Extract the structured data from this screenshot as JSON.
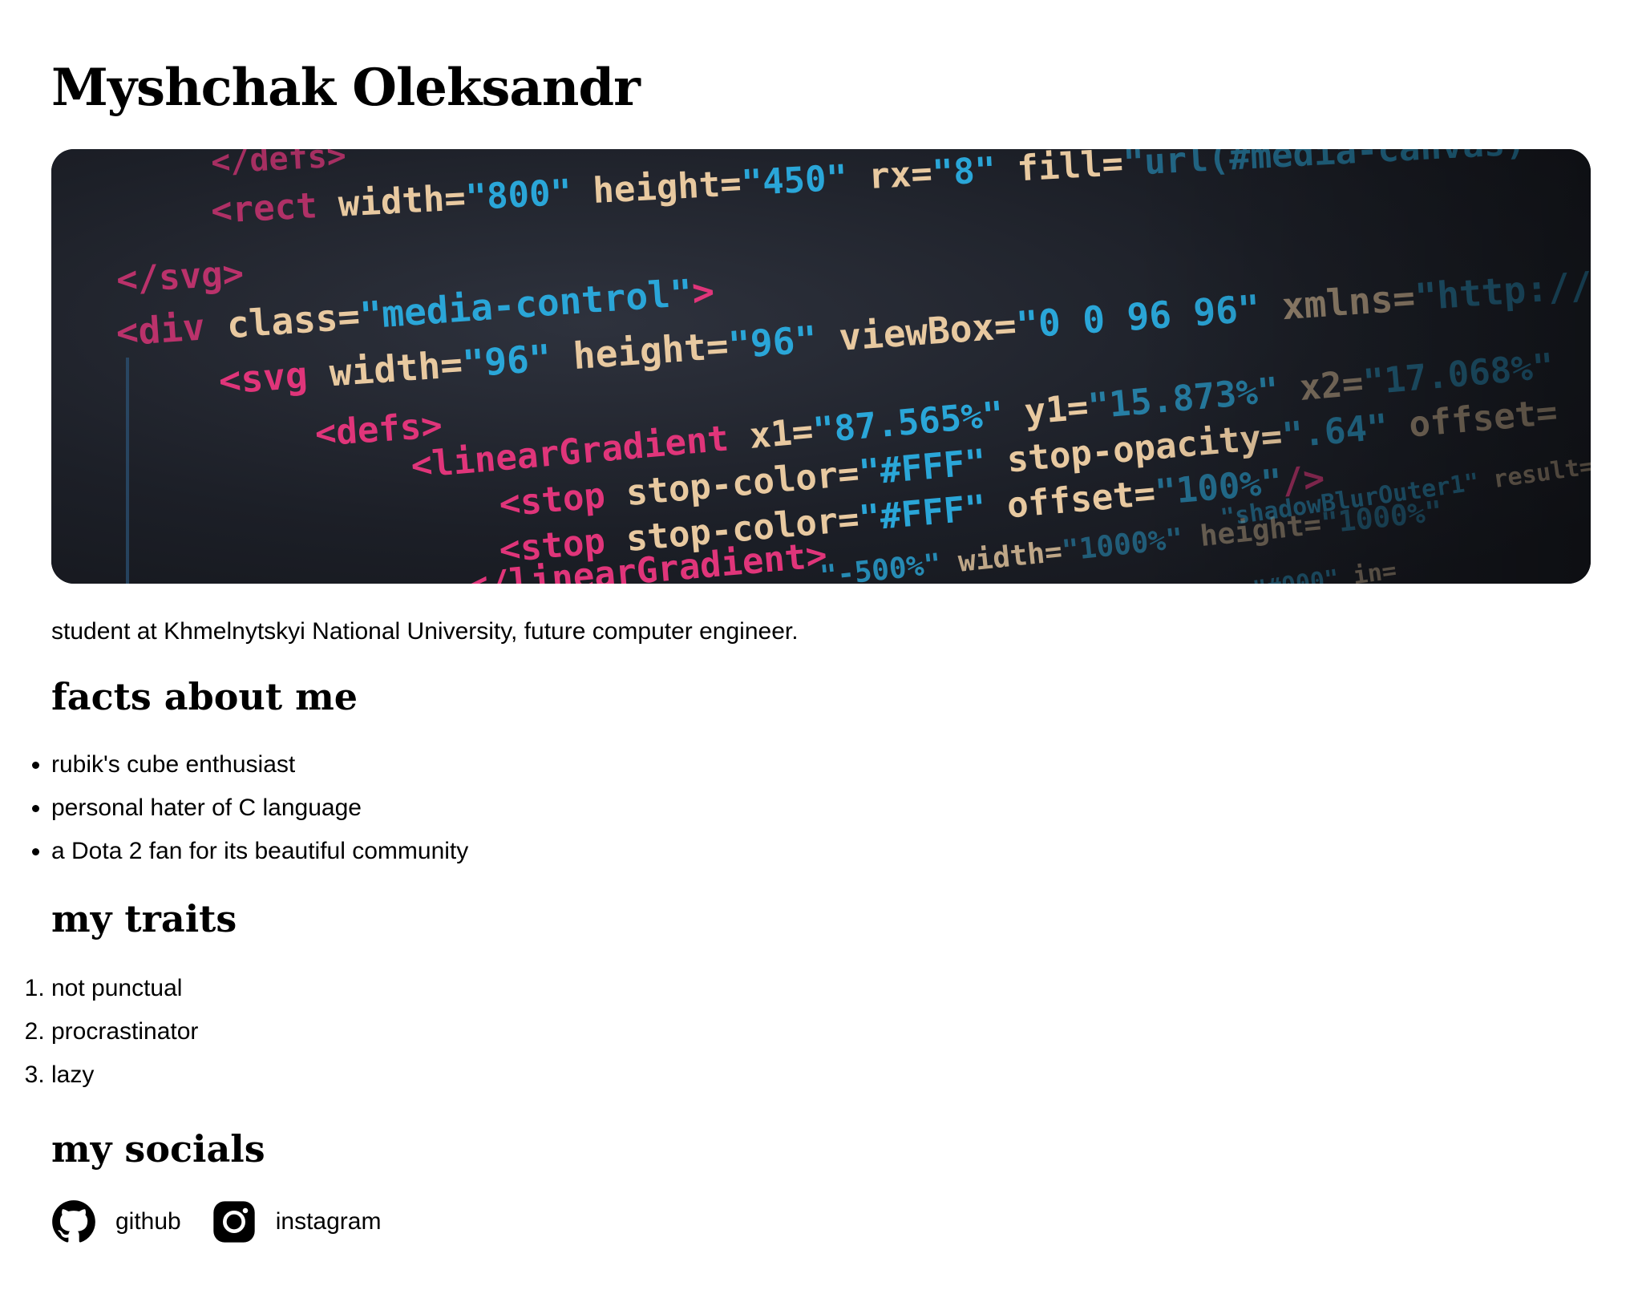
{
  "header": {
    "name": "Myshchak Oleksandr"
  },
  "banner": {
    "lines": [
      "</defs>",
      "<rect width=\"800\" height=\"450\" rx=\"8\" fill=\"url(#media-canvas)\"",
      "</svg>",
      "<div class=\"media-control\">",
      "<svg width=\"96\" height=\"96\" viewBox=\"0 0 96 96\" xmlns=",
      "<defs>",
      "<linearGradient x1=\"87.565%\" y1=\"15.873%\"",
      "<stop stop-color=\"#FFF\" stop-opacity=\".64\" offset=",
      "<stop stop-color=\"#FFF\" offset=\"100%\"/>",
      "</linearGradient>",
      "\"-500%\" width=\"1000%\" height=\"1000%\""
    ],
    "colors": {
      "tag": "#e0357a",
      "attr": "#e8c9a0",
      "value": "#2aa6d8",
      "background": "#1b1e26"
    }
  },
  "intro": {
    "tagline": "student at Khmelnytskyi National University, future computer engineer."
  },
  "facts": {
    "heading": "facts about me",
    "items": [
      "rubik's cube enthusiast",
      "personal hater of C language",
      "a Dota 2 fan for its beautiful community"
    ]
  },
  "traits": {
    "heading": "my traits",
    "items": [
      "not punctual",
      "procrastinator",
      "lazy"
    ]
  },
  "socials": {
    "heading": "my socials",
    "links": [
      {
        "label": "github",
        "icon": "github-icon"
      },
      {
        "label": "instagram",
        "icon": "instagram-icon"
      }
    ]
  }
}
